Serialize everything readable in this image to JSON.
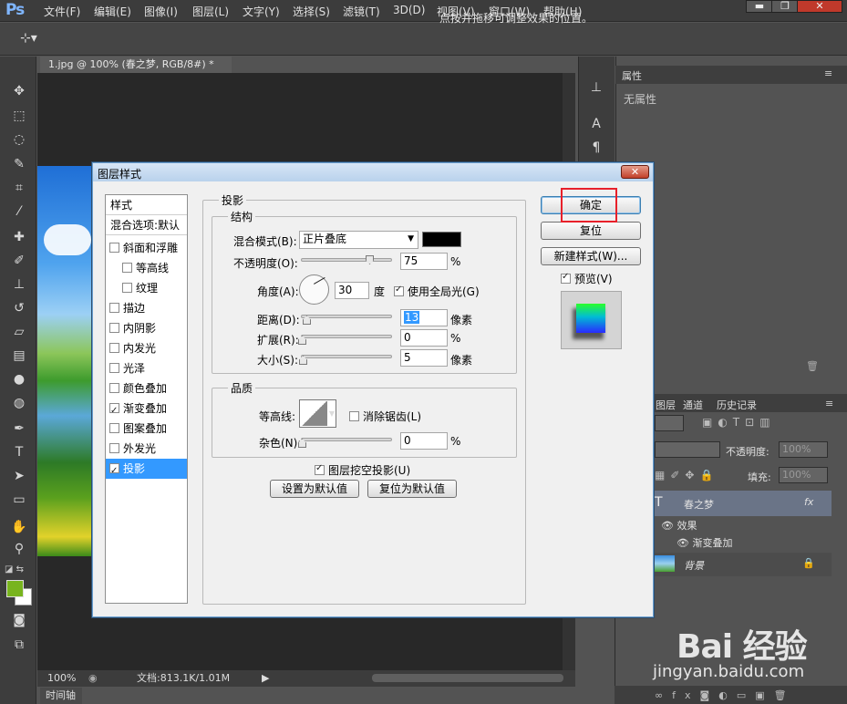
{
  "app": {
    "logo": "Ps",
    "menus": [
      "文件(F)",
      "编辑(E)",
      "图像(I)",
      "图层(L)",
      "文字(Y)",
      "选择(S)",
      "滤镜(T)",
      "3D(D)",
      "视图(V)",
      "窗口(W)",
      "帮助(H)"
    ],
    "window_controls": [
      "▬",
      "❐",
      "✕"
    ]
  },
  "options_bar": {
    "hint": "点按并拖移可调整效果的位置。"
  },
  "document": {
    "tab_title": "1.jpg @ 100% (春之梦, RGB/8#) *",
    "tab_close": "×",
    "zoom": "100%",
    "doc_info": "文档:813.1K/1.01M",
    "timeline": "时间轴"
  },
  "colors": {
    "foreground": "#78b41e",
    "background": "#ffffff",
    "highlight": "#e8202a"
  },
  "properties_panel": {
    "tab": "属性",
    "body": "无属性"
  },
  "layers_panel": {
    "tabs": [
      "图层",
      "通道",
      "历史记录"
    ],
    "opacity_label": "不透明度:",
    "opacity_value": "100%",
    "fill_label": "填充:",
    "fill_value": "100%",
    "layers": [
      {
        "name": "春之梦",
        "fx": "fx"
      },
      {
        "name": "效果"
      },
      {
        "name": "渐变叠加"
      },
      {
        "name": "背景"
      }
    ]
  },
  "dialog": {
    "title": "图层样式",
    "close": "✕",
    "styles": [
      {
        "label": "样式",
        "kind": "header"
      },
      {
        "label": "混合选项:默认",
        "kind": "header"
      },
      {
        "label": "斜面和浮雕",
        "checked": false,
        "indent": false
      },
      {
        "label": "等高线",
        "checked": false,
        "indent": true
      },
      {
        "label": "纹理",
        "checked": false,
        "indent": true
      },
      {
        "label": "描边",
        "checked": false,
        "indent": false
      },
      {
        "label": "内阴影",
        "checked": false,
        "indent": false
      },
      {
        "label": "内发光",
        "checked": false,
        "indent": false
      },
      {
        "label": "光泽",
        "checked": false,
        "indent": false
      },
      {
        "label": "颜色叠加",
        "checked": false,
        "indent": false
      },
      {
        "label": "渐变叠加",
        "checked": true,
        "indent": false
      },
      {
        "label": "图案叠加",
        "checked": false,
        "indent": false
      },
      {
        "label": "外发光",
        "checked": false,
        "indent": false
      },
      {
        "label": "投影",
        "checked": true,
        "indent": false,
        "selected": true
      }
    ],
    "section_title": "投影",
    "structure": {
      "title": "结构",
      "blend_mode_label": "混合模式(B):",
      "blend_mode_value": "正片叠底",
      "shadow_color": "#000000",
      "opacity_label": "不透明度(O):",
      "opacity_value": "75",
      "opacity_fraction": 0.75,
      "angle_label": "角度(A):",
      "angle_value": "30",
      "angle_unit": "度",
      "global_light_label": "使用全局光(G)",
      "global_light_checked": true,
      "distance_label": "距离(D):",
      "distance_value": "13",
      "distance_fraction": 0.06,
      "spread_label": "扩展(R):",
      "spread_value": "0",
      "size_label": "大小(S):",
      "size_value": "5",
      "size_fraction": 0.02,
      "unit_percent": "%",
      "unit_px": "像素"
    },
    "quality": {
      "title": "品质",
      "contour_label": "等高线:",
      "anti_alias_label": "消除锯齿(L)",
      "anti_alias_checked": false,
      "noise_label": "杂色(N):",
      "noise_value": "0",
      "unit_percent": "%"
    },
    "knockout_label": "图层挖空投影(U)",
    "knockout_checked": true,
    "set_default_btn": "设置为默认值",
    "reset_default_btn": "复位为默认值",
    "ok_btn": "确定",
    "reset_btn": "复位",
    "new_style_btn": "新建样式(W)...",
    "preview_label": "预览(V)",
    "preview_checked": true
  },
  "watermark": {
    "brand": "Bai 经验",
    "url": "jingyan.baidu.com"
  }
}
